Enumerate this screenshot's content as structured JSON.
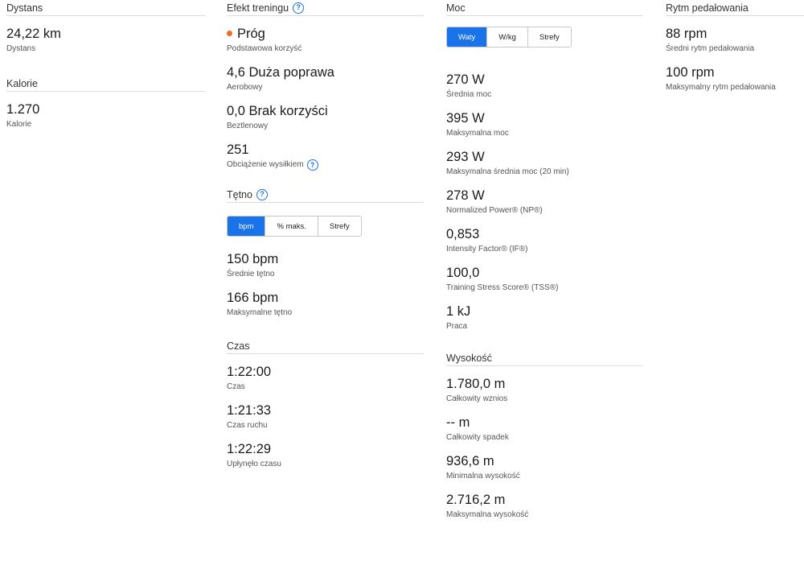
{
  "col1": {
    "distance": {
      "header": "Dystans",
      "value": "24,22 km",
      "label": "Dystans"
    },
    "calories": {
      "header": "Kalorie",
      "value": "1.270",
      "label": "Kalorie"
    }
  },
  "training_effect": {
    "header": "Efekt treningu",
    "primary": {
      "value": "Próg",
      "label": "Podstawowa korzyść",
      "dot_color": "#f26b21"
    },
    "aerobic": {
      "value": "4,6 Duża poprawa",
      "label": "Aerobowy"
    },
    "anaerobic": {
      "value": "0,0 Brak korzyści",
      "label": "Beztlenowy"
    },
    "load": {
      "value": "251",
      "label": "Obciążenie wysiłkiem"
    }
  },
  "heart_rate": {
    "header": "Tętno",
    "tabs": [
      "bpm",
      "% maks.",
      "Strefy"
    ],
    "active_tab": 0,
    "avg": {
      "value": "150 bpm",
      "label": "Średnie tętno"
    },
    "max": {
      "value": "166 bpm",
      "label": "Maksymalne tętno"
    }
  },
  "time": {
    "header": "Czas",
    "total": {
      "value": "1:22:00",
      "label": "Czas"
    },
    "moving": {
      "value": "1:21:33",
      "label": "Czas ruchu"
    },
    "elapsed": {
      "value": "1:22:29",
      "label": "Upłynęło czasu"
    }
  },
  "power": {
    "header": "Moc",
    "tabs": [
      "Waty",
      "W/kg",
      "Strefy"
    ],
    "active_tab": 0,
    "stats": [
      {
        "value": "270 W",
        "label": "Średnia moc"
      },
      {
        "value": "395 W",
        "label": "Maksymalna moc"
      },
      {
        "value": "293 W",
        "label": "Maksymalna średnia moc (20 min)"
      },
      {
        "value": "278 W",
        "label": "Normalized Power® (NP®)"
      },
      {
        "value": "0,853",
        "label": "Intensity Factor® (IF®)"
      },
      {
        "value": "100,0",
        "label": "Training Stress Score® (TSS®)"
      },
      {
        "value": "1 kJ",
        "label": "Praca"
      }
    ]
  },
  "elevation": {
    "header": "Wysokość",
    "stats": [
      {
        "value": "1.780,0 m",
        "label": "Całkowity wznios"
      },
      {
        "value": "-- m",
        "label": "Całkowity spadek"
      },
      {
        "value": "936,6 m",
        "label": "Minimalna wysokość"
      },
      {
        "value": "2.716,2 m",
        "label": "Maksymalna wysokość"
      }
    ]
  },
  "cadence": {
    "header": "Rytm pedałowania",
    "avg": {
      "value": "88 rpm",
      "label": "Średni rytm pedałowania"
    },
    "max": {
      "value": "100 rpm",
      "label": "Maksymalny rytm pedałowania"
    }
  },
  "colors": {
    "accent": "#1a73e8",
    "primary_dot": "#f26b21"
  },
  "icons": {
    "help": "help-circle-icon"
  }
}
